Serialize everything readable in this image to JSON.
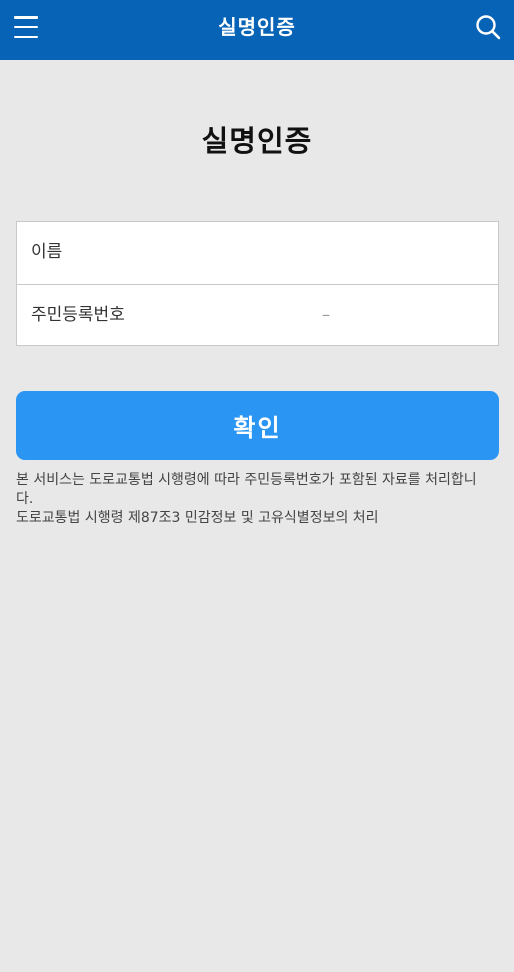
{
  "header": {
    "title": "실명인증",
    "menu_icon": "hamburger-menu-icon",
    "search_icon": "search-icon",
    "background_color": "#0763b5"
  },
  "main": {
    "title": "실명인증",
    "form": {
      "name_label": "이름",
      "rrn_label": "주민등록번호",
      "rrn_separator": "–"
    },
    "confirm_label": "확인",
    "confirm_color": "#2b95f3",
    "notice": [
      "본 서비스는 도로교통법 시행령에 따라 주민등록번호가 포함된 자료를 처리합니다.",
      "도로교통법 시행령 제87조3 민감정보 및 고유식별정보의 처리"
    ]
  }
}
